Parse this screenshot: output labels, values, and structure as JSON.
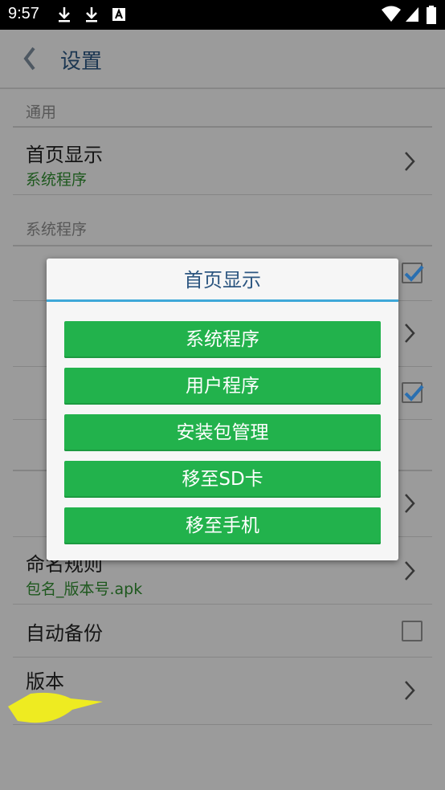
{
  "status_bar": {
    "time": "9:57"
  },
  "app_bar": {
    "title": "设置"
  },
  "sections": {
    "general": "通用",
    "system": "系统程序"
  },
  "rows": {
    "home_display": {
      "label": "首页显示",
      "value": "系统程序"
    },
    "naming_rule": {
      "label": "命名规则",
      "value": "包名_版本号.apk"
    },
    "auto_backup": {
      "label": "自动备份"
    },
    "version": {
      "label": "版本"
    }
  },
  "dialog": {
    "title": "首页显示",
    "options": [
      "系统程序",
      "用户程序",
      "安装包管理",
      "移至SD卡",
      "移至手机"
    ]
  }
}
